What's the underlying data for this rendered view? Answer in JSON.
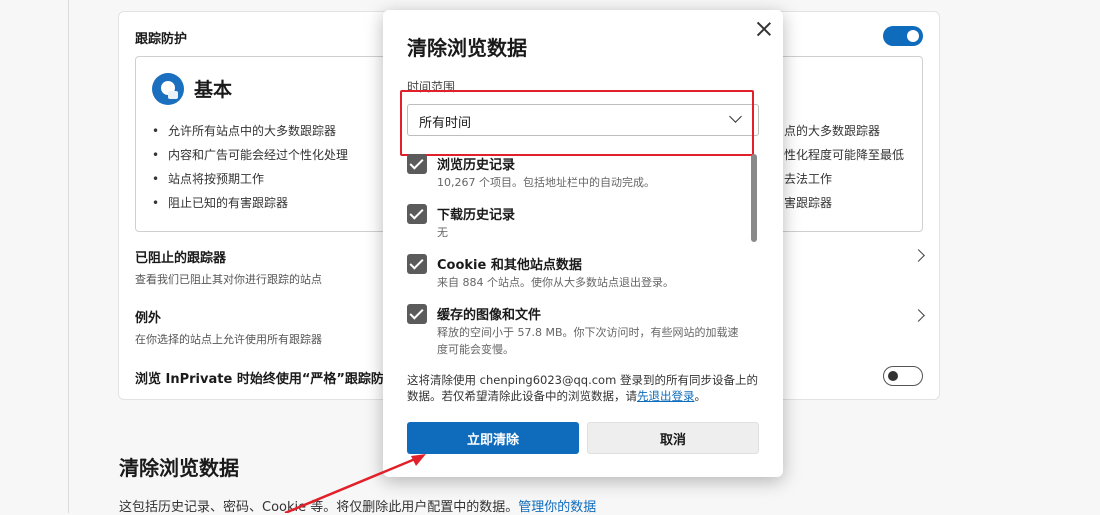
{
  "settings": {
    "tracking_title": "跟踪防护",
    "tracking_enabled": true,
    "basic": {
      "title": "基本",
      "icon": "shield-person-icon",
      "bullets": [
        "允许所有站点中的大多数跟踪器",
        "内容和广告可能会经过个性化处理",
        "站点将按预期工作",
        "阻止已知的有害跟踪器"
      ]
    },
    "right_partial_bullets": [
      "点的大多数跟踪器",
      "性化程度可能降至最低",
      "去法工作",
      "害跟踪器"
    ],
    "blocked_trackers": {
      "title": "已阻止的跟踪器",
      "desc": "查看我们已阻止其对你进行跟踪的站点"
    },
    "exceptions": {
      "title": "例外",
      "desc": "在你选择的站点上允许使用所有跟踪器"
    },
    "inprivate": {
      "label": "浏览 InPrivate 时始终使用“严格”跟踪防",
      "enabled": false
    },
    "clear_section_title": "清除浏览数据",
    "clear_section_desc": "这包括历史记录、密码、Cookie 等。将仅删除此用户配置中的数据。",
    "clear_section_link": "管理你的数据"
  },
  "dialog": {
    "title": "清除浏览数据",
    "time_range_label": "时间范围",
    "time_range_value": "所有时间",
    "items": [
      {
        "title": "浏览历史记录",
        "desc": "10,267 个项目。包括地址栏中的自动完成。",
        "checked": true
      },
      {
        "title": "下载历史记录",
        "desc": "无",
        "checked": true
      },
      {
        "title": "Cookie 和其他站点数据",
        "desc": "来自 884 个站点。使你从大多数站点退出登录。",
        "checked": true
      },
      {
        "title": "缓存的图像和文件",
        "desc": "释放的空间小于 57.8 MB。你下次访问时，有些网站的加载速度可能会变慢。",
        "checked": true
      }
    ],
    "note_text": "这将清除使用 chenping6023@qq.com 登录到的所有同步设备上的数据。若仅希望清除此设备中的浏览数据，请",
    "note_link": "先退出登录",
    "note_end": "。",
    "clear_button": "立即清除",
    "cancel_button": "取消"
  },
  "colors": {
    "accent": "#0f6cbd",
    "highlight": "#e2202a"
  }
}
